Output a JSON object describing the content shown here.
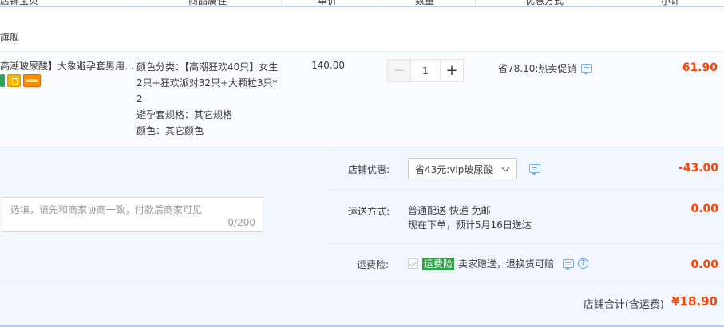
{
  "table_header": {
    "col_item": "店铺宝贝",
    "col_props": "商品属性",
    "col_price": "单价",
    "col_qty": "数量",
    "col_promo": "优惠方式",
    "col_subtotal": "小计"
  },
  "shop": {
    "name": "旗舰"
  },
  "item": {
    "title": "高潮玻尿酸】大象避孕套男用...",
    "props": [
      "颜色分类：【高潮狂欢40只】女生2只+狂欢派对32只+大颗粒3只*2",
      "避孕套规格：其它规格",
      "颜色：其它颜色"
    ],
    "price": "140.00",
    "quantity": "1",
    "minus_symbol": "−",
    "plus_symbol": "+",
    "promo": "省78.10:热卖促销",
    "subtotal": "61.90"
  },
  "order": {
    "note_placeholder": "选填，请先和商家协商一致，付款后商家可见",
    "note_count": "0/200",
    "shop_discount_label": "店铺优惠:",
    "shop_discount_selected": "省43元:vip玻尿酸",
    "shop_discount_amount": "-43.00",
    "shipping_label": "运送方式:",
    "shipping_method": "普通配送 快递 免邮",
    "shipping_eta": "现在下单，预计5月16日送达",
    "shipping_amount": "0.00",
    "insurance_label": "运费险:",
    "insurance_tag": "运费险",
    "insurance_text": "卖家赠送，退换货可赔",
    "insurance_amount": "0.00"
  },
  "total": {
    "label": "店铺合计(含运费)",
    "amount": "¥18.90"
  },
  "icons": {
    "chat": "chat-bubble-icon",
    "help": "help-icon",
    "help_glyph": "?"
  },
  "colors": {
    "accent_price": "#ff4400",
    "header_border": "#b2d1ff",
    "insurance_green": "#33a14a"
  }
}
